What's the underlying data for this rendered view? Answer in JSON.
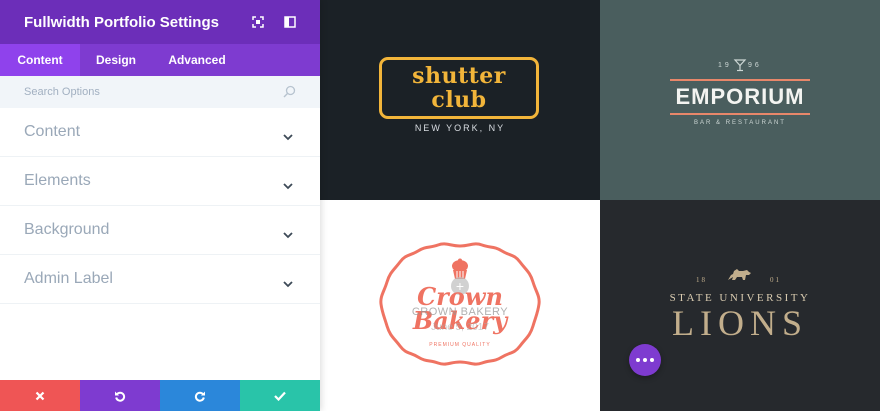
{
  "panel": {
    "title": "Fullwidth Portfolio Settings",
    "tabs": [
      {
        "label": "Content",
        "active": true
      },
      {
        "label": "Design",
        "active": false
      },
      {
        "label": "Advanced",
        "active": false
      }
    ],
    "search_placeholder": "Search Options",
    "toggles": [
      {
        "label": "Content"
      },
      {
        "label": "Elements"
      },
      {
        "label": "Background"
      },
      {
        "label": "Admin Label"
      }
    ],
    "actions": [
      "close-icon",
      "undo-icon",
      "redo-icon",
      "check-icon"
    ]
  },
  "colors": {
    "header": "#6c2eb9",
    "tabs": "#7e3bd0",
    "close": "#ef5555",
    "undo": "#7e3bd0",
    "redo": "#2b87da",
    "save": "#29c4a9"
  },
  "portfolio": {
    "shutter": {
      "line1": "shutter",
      "line2": "club",
      "sub": "NEW YORK, NY"
    },
    "emporium": {
      "year1": "19",
      "year2": "96",
      "title": "EMPORIUM",
      "sub": "BAR & RESTAURANT"
    },
    "crown": {
      "word1": "Crown",
      "word2": "Bakery",
      "quality": "PREMIUM QUALITY",
      "overlay_title": "CROWN BAKERY",
      "overlay_date": "June 5, 2017"
    },
    "lions": {
      "year1": "18",
      "year2": "01",
      "university": "STATE UNIVERSITY",
      "title": "LIONS"
    }
  }
}
